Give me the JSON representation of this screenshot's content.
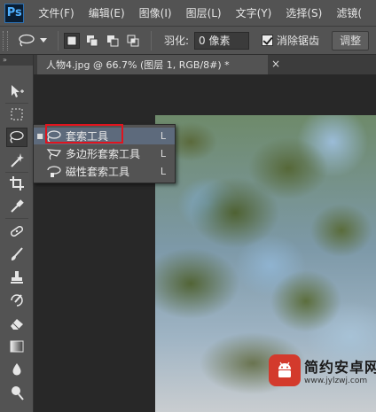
{
  "app": {
    "logo": "Ps"
  },
  "menu": [
    "文件(F)",
    "编辑(E)",
    "图像(I)",
    "图层(L)",
    "文字(Y)",
    "选择(S)",
    "滤镜("
  ],
  "options": {
    "feather_label": "羽化:",
    "feather_value": "0 像素",
    "antialias_label": "消除锯齿",
    "antialias_checked": true,
    "adjust_label": "调整"
  },
  "tool_panel": {
    "collapse_glyph": "»"
  },
  "document": {
    "tab_title": "人物4.jpg @ 66.7% (图层 1, RGB/8#) *",
    "close_glyph": "×"
  },
  "flyout": {
    "items": [
      {
        "label": "套索工具",
        "shortcut": "L",
        "icon": "lasso-icon",
        "selected": true
      },
      {
        "label": "多边形套索工具",
        "shortcut": "L",
        "icon": "polygonal-lasso-icon",
        "selected": false
      },
      {
        "label": "磁性套索工具",
        "shortcut": "L",
        "icon": "magnetic-lasso-icon",
        "selected": false
      }
    ],
    "bullet": "■"
  },
  "watermark": {
    "title": "简约安卓网",
    "url": "www.jylzwj.com"
  },
  "colors": {
    "highlight": "#e0141e",
    "panel": "#535353",
    "workspace": "#282828"
  }
}
